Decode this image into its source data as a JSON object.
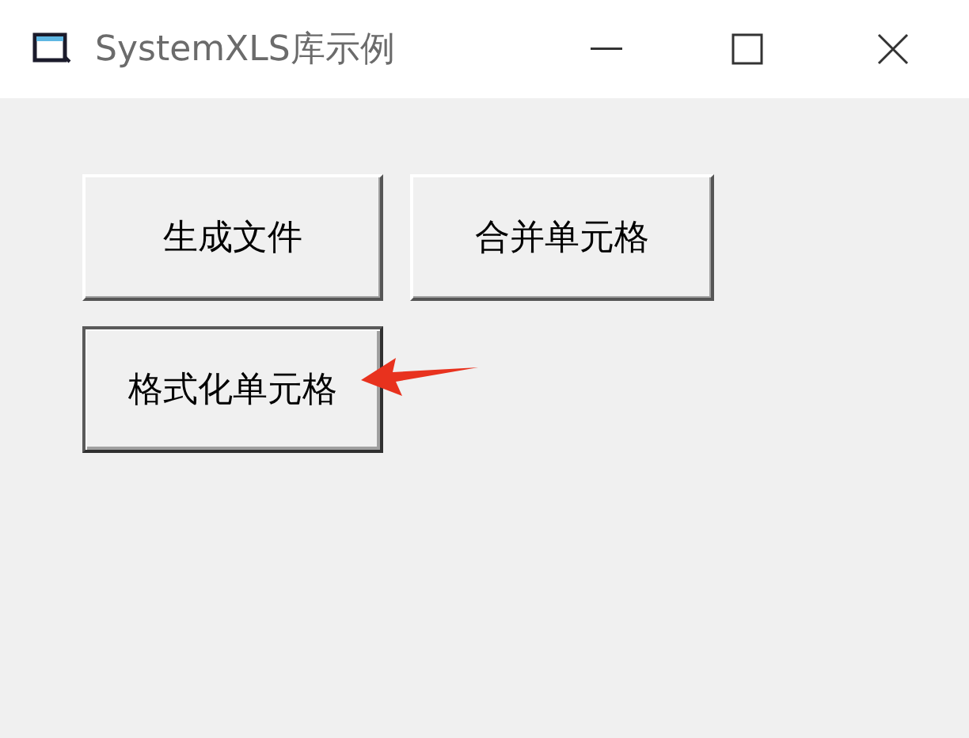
{
  "window": {
    "title": "SystemXLS库示例"
  },
  "buttons": [
    {
      "label": "生成文件",
      "focused": false
    },
    {
      "label": "合并单元格",
      "focused": false
    },
    {
      "label": "格式化单元格",
      "focused": true
    }
  ]
}
